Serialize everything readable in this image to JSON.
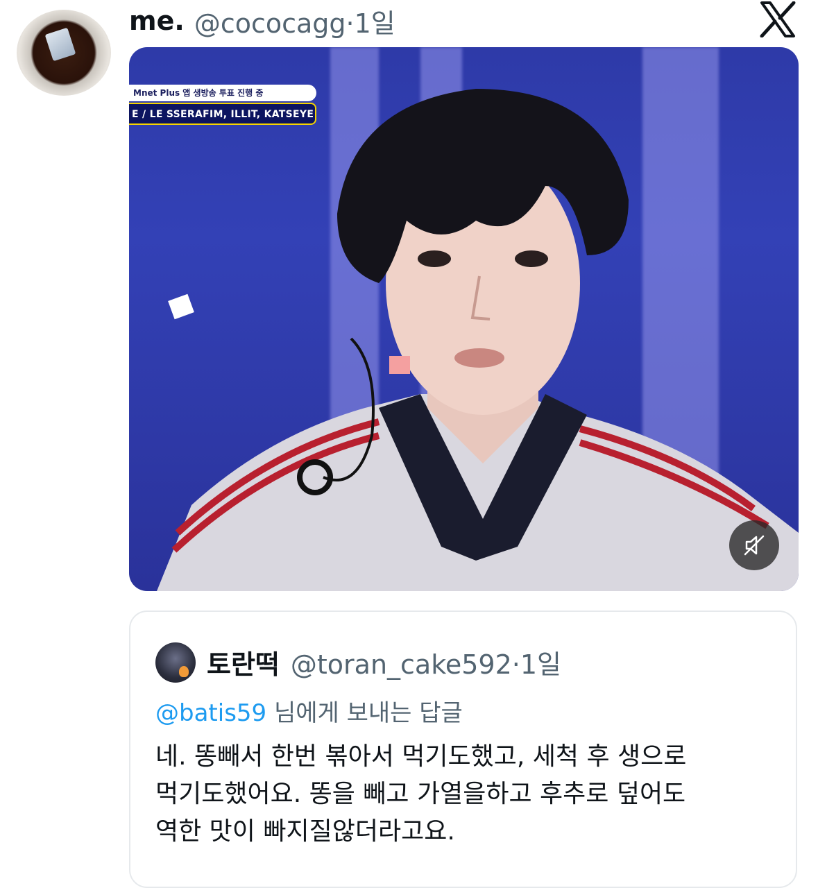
{
  "tweet": {
    "author_name": "me.",
    "author_handle": "@cococagg",
    "separator": "·",
    "time": "1일"
  },
  "media": {
    "overlay_line1": "Mnet Plus 앱 생방송 투표 진행 중",
    "overlay_line2": "E / LE SSERAFIM, ILLIT, KATSEYE",
    "mute_icon": "speaker-muted-icon"
  },
  "quote": {
    "author_name": "토란떡",
    "author_handle": "@toran_cake592",
    "separator": "·",
    "time": "1일",
    "reply_mention": "@batis59",
    "reply_suffix": " 님에게 보내는 답글",
    "text_line1": "네. 똥빼서 한번 볶아서 먹기도했고, 세척 후 생으로",
    "text_line2": "먹기도했어요. 똥을 빼고 가열을하고 후추로 덮어도",
    "text_line3": "역한 맛이 빠지질않더라고요."
  },
  "colors": {
    "text_primary": "#0f1419",
    "text_secondary": "#536471",
    "link": "#1d9bf0",
    "border": "#e6e9ec"
  }
}
